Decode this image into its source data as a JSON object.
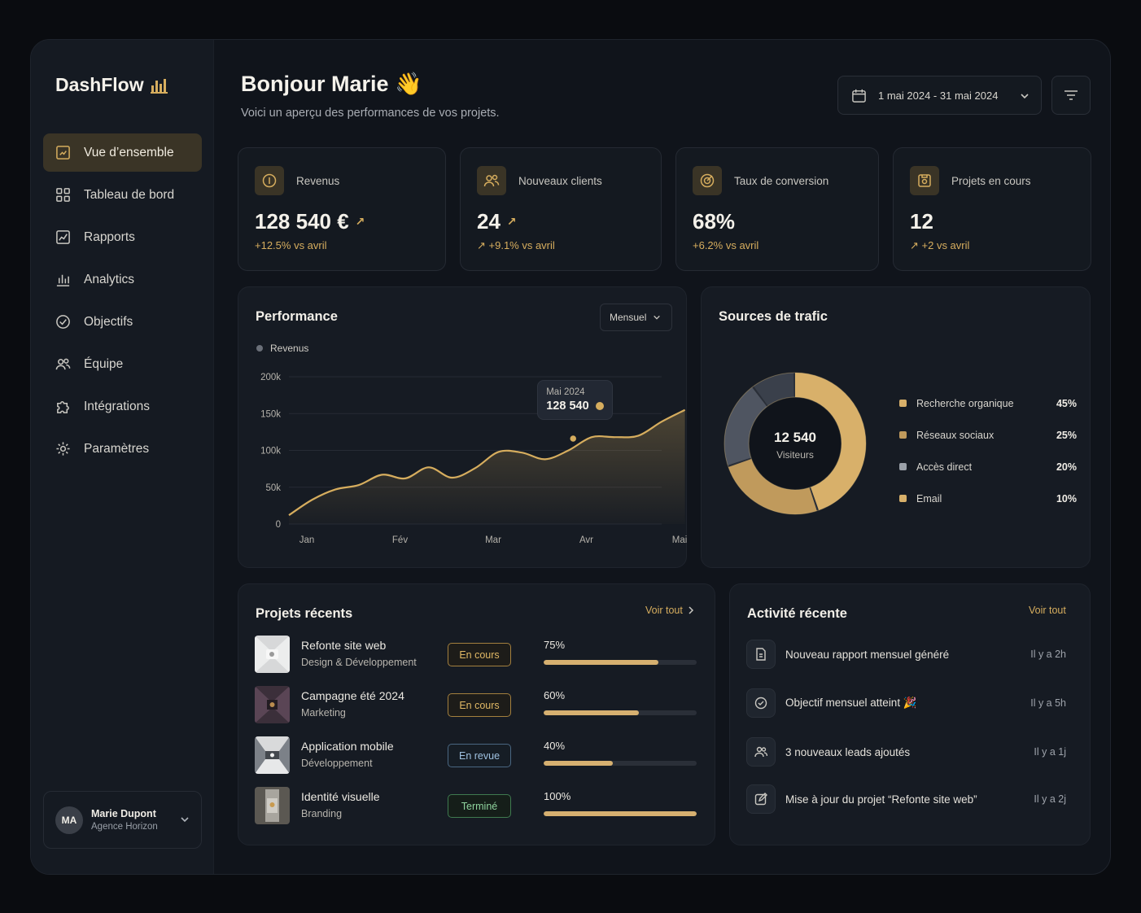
{
  "brand": {
    "name": "DashFlow"
  },
  "sidebar": {
    "items": [
      {
        "label": "Vue d’ensemble",
        "icon": "overview-icon",
        "active": true
      },
      {
        "label": "Tableau de bord",
        "icon": "dashboard-grid-icon"
      },
      {
        "label": "Rapports",
        "icon": "report-chart-icon"
      },
      {
        "label": "Analytics",
        "icon": "bar-chart-icon"
      },
      {
        "label": "Objectifs",
        "icon": "check-circle-icon"
      },
      {
        "label": "Équipe",
        "icon": "team-icon"
      },
      {
        "label": "Intégrations",
        "icon": "puzzle-icon"
      },
      {
        "label": "Paramètres",
        "icon": "gear-icon"
      }
    ],
    "user": {
      "initials": "MA",
      "name": "Marie Dupont",
      "org": "Agence Horizon"
    }
  },
  "header": {
    "greeting": "Bonjour Marie 👋",
    "subtitle": "Voici un aperçu des performances de vos projets.",
    "date_range": "1 mai 2024 - 31 mai 2024"
  },
  "kpis": [
    {
      "label": "Revenus",
      "value": "128 540 €",
      "trend": "↗",
      "delta": "+12.5% vs avril",
      "icon": "revenue-icon"
    },
    {
      "label": "Nouveaux clients",
      "value": "24",
      "trend": "↗",
      "delta": "↗ +9.1% vs avril",
      "icon": "clients-icon"
    },
    {
      "label": "Taux de conversion",
      "value": "68%",
      "trend": "",
      "delta": "+6.2% vs avril",
      "icon": "target-icon"
    },
    {
      "label": "Projets en cours",
      "value": "12",
      "trend": "",
      "delta": "↗ +2 vs avril",
      "icon": "projects-icon"
    }
  ],
  "performance": {
    "title": "Performance",
    "period": "Mensuel",
    "tooltip": {
      "label": "Mai 2024",
      "value": "128 540"
    }
  },
  "chart_data": {
    "type": "area",
    "title": "Performance",
    "series": [
      {
        "name": "Revenus",
        "color": "#d6ad5e"
      }
    ],
    "x": [
      "Jan",
      "Fév",
      "Mar",
      "Avr",
      "Mai"
    ],
    "y_ticks": [
      "0",
      "50k",
      "100k",
      "150k",
      "200k"
    ],
    "ylim": [
      0,
      200000
    ],
    "points": [
      {
        "x": 0.0,
        "y": 12000
      },
      {
        "x": 0.25,
        "y": 33000
      },
      {
        "x": 0.5,
        "y": 47000
      },
      {
        "x": 0.75,
        "y": 53000
      },
      {
        "x": 1.0,
        "y": 67000
      },
      {
        "x": 1.25,
        "y": 62000
      },
      {
        "x": 1.5,
        "y": 77000
      },
      {
        "x": 1.75,
        "y": 63000
      },
      {
        "x": 2.0,
        "y": 76000
      },
      {
        "x": 2.25,
        "y": 98000
      },
      {
        "x": 2.5,
        "y": 97000
      },
      {
        "x": 2.75,
        "y": 88000
      },
      {
        "x": 3.0,
        "y": 100000
      },
      {
        "x": 3.25,
        "y": 118000
      },
      {
        "x": 3.5,
        "y": 118000
      },
      {
        "x": 3.75,
        "y": 120000
      },
      {
        "x": 4.0,
        "y": 139000
      },
      {
        "x": 4.25,
        "y": 155000
      }
    ],
    "highlight": {
      "x": 3.05,
      "y": 116000
    }
  },
  "traffic": {
    "title": "Sources de trafic",
    "total": "12 540",
    "total_label": "Visiteurs",
    "sources": [
      {
        "label": "Recherche organique",
        "pct": "45%",
        "value": 45,
        "color": "#d8b06a"
      },
      {
        "label": "Réseaux sociaux",
        "pct": "25%",
        "value": 25,
        "color": "#c09a5c"
      },
      {
        "label": "Accès direct",
        "pct": "20%",
        "value": 20,
        "color": "#4f5561"
      },
      {
        "label": "Email",
        "pct": "10%",
        "value": 10,
        "color": "#3a404b"
      }
    ]
  },
  "projects": {
    "title": "Projets récents",
    "see_all": "Voir tout",
    "items": [
      {
        "name": "Refonte site web",
        "category": "Design & Développement",
        "status": "En cours",
        "status_kind": "gold",
        "progress_label": "75%",
        "progress": 0.75
      },
      {
        "name": "Campagne été 2024",
        "category": "Marketing",
        "status": "En cours",
        "status_kind": "gold",
        "progress_label": "60%",
        "progress": 0.62
      },
      {
        "name": "Application mobile",
        "category": "Développement",
        "status": "En revue",
        "status_kind": "blue",
        "progress_label": "40%",
        "progress": 0.45
      },
      {
        "name": "Identité visuelle",
        "category": "Branding",
        "status": "Terminé",
        "status_kind": "green",
        "progress_label": "100%",
        "progress": 1.0
      }
    ]
  },
  "activity": {
    "title": "Activité récente",
    "see_all": "Voir tout",
    "items": [
      {
        "text": "Nouveau rapport mensuel généré",
        "time": "Il y a 2h",
        "icon": "document-icon"
      },
      {
        "text": "Objectif mensuel atteint 🎉",
        "time": "Il y a 5h",
        "icon": "target-check-icon"
      },
      {
        "text": "3 nouveaux leads ajoutés",
        "time": "Il y a 1j",
        "icon": "users-icon"
      },
      {
        "text": "Mise à jour du projet “Refonte site web”",
        "time": "Il y a 2j",
        "icon": "edit-icon"
      }
    ]
  }
}
